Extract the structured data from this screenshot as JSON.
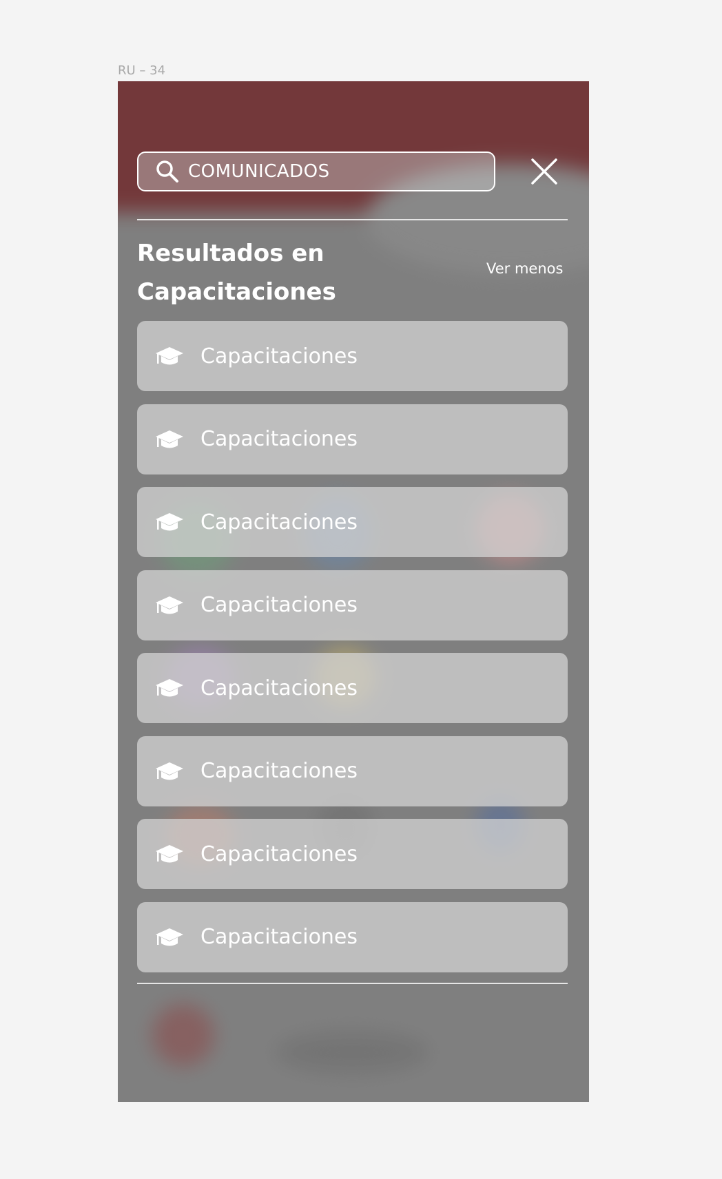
{
  "frame_label": "RU – 34",
  "search": {
    "value": "COMUNICADOS"
  },
  "section": {
    "title": "Resultados en\nCapacitaciones",
    "toggle_label": "Ver menos"
  },
  "results": [
    {
      "label": "Capacitaciones",
      "icon": "graduation-cap-icon"
    },
    {
      "label": "Capacitaciones",
      "icon": "graduation-cap-icon"
    },
    {
      "label": "Capacitaciones",
      "icon": "graduation-cap-icon"
    },
    {
      "label": "Capacitaciones",
      "icon": "graduation-cap-icon"
    },
    {
      "label": "Capacitaciones",
      "icon": "graduation-cap-icon"
    },
    {
      "label": "Capacitaciones",
      "icon": "graduation-cap-icon"
    },
    {
      "label": "Capacitaciones",
      "icon": "graduation-cap-icon"
    },
    {
      "label": "Capacitaciones",
      "icon": "graduation-cap-icon"
    }
  ],
  "colors": {
    "page_bg": "#f4f4f4",
    "overlay": "#7f7f7f",
    "header_red": "#6c1215",
    "text": "#ffffff",
    "card": "#d7d7d7"
  }
}
